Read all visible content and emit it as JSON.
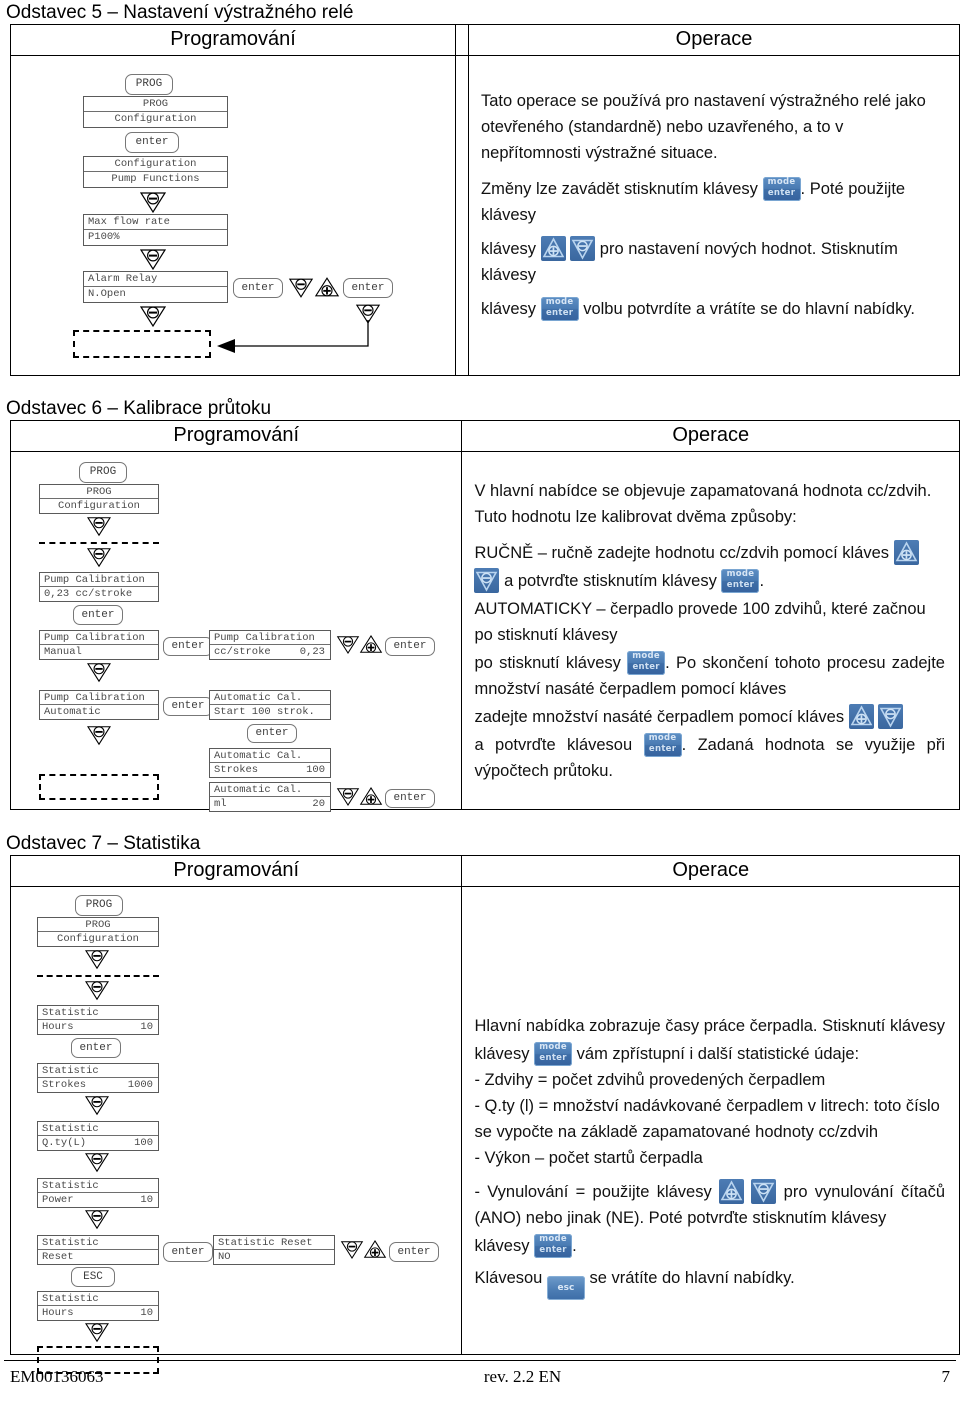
{
  "sections": [
    {
      "id": "sec5",
      "title": "Odstavec 5 – Nastavení výstražného relé",
      "col_left_header": "Programování",
      "col_right_header": "Operace",
      "diagram": {
        "buttons": [
          {
            "label": "PROG"
          },
          {
            "label": "enter"
          },
          {
            "label": "enter"
          },
          {
            "label": "enter"
          }
        ],
        "screens": [
          {
            "line1": "PROG",
            "line2": "Configuration"
          },
          {
            "line1": "Configuration",
            "line2": "Pump Functions"
          },
          {
            "line1": "Max flow rate",
            "line2": "P100%"
          },
          {
            "line1": "Alarm Relay",
            "line2": "N.Open"
          }
        ]
      },
      "prose": {
        "p1": "Tato operace se používá pro nastavení výstražného relé jako otevřeného (standardně) nebo uzavřeného, a to v nepřítomnosti výstražné situace.",
        "p2a": "Změny lze zavádět stisknutím klávesy",
        "p2b": ". Poté použijte klávesy",
        "p2c": "pro nastavení nových hodnot. Stisknutím klávesy",
        "p2d": "volbu potvrdíte a vrátíte se do hlavní nabídky."
      }
    },
    {
      "id": "sec6",
      "title": "Odstavec 6 – Kalibrace průtoku",
      "col_left_header": "Programování",
      "col_right_header": "Operace",
      "diagram": {
        "buttons": [
          {
            "label": "PROG"
          },
          {
            "label": "enter"
          },
          {
            "label": "enter"
          },
          {
            "label": "enter"
          },
          {
            "label": "enter"
          },
          {
            "label": "enter"
          },
          {
            "label": "enter"
          }
        ],
        "screens": [
          {
            "line1": "PROG",
            "line2": "Configuration"
          },
          {
            "line1": "Pump Calibration",
            "line2": "0,23 cc/stroke"
          },
          {
            "line1": "Pump Calibration",
            "line2": "Manual"
          },
          {
            "line1": "Pump Calibration",
            "line2_left": "cc/stroke",
            "line2_right": "0,23"
          },
          {
            "line1": "Pump Calibration",
            "line2": "Automatic"
          },
          {
            "line1": "Automatic Cal.",
            "line2": "Start 100 strok."
          },
          {
            "line1": "Automatic Cal.",
            "line2_left": "Strokes",
            "line2_right": "100"
          },
          {
            "line1": "Automatic Cal.",
            "line2_left": "ml",
            "line2_right": "20"
          }
        ]
      },
      "prose": {
        "p1": "V hlavní nabídce se objevuje zapamatovaná hodnota cc/zdvih. Tuto hodnotu lze kalibrovat dvěma způsoby:",
        "p2a": "RUČNĚ – ručně zadejte hodnotu cc/zdvih pomocí kláves",
        "p2b": "a potvrďte stisknutím klávesy",
        "p2c": ".",
        "p3a": "AUTOMATICKY – čerpadlo provede 100 zdvihů, které začnou po stisknutí klávesy",
        "p3b": ". Po skončení tohoto procesu zadejte množství nasáté čerpadlem pomocí kláves",
        "p3c": "a potvrďte klávesou",
        "p3d": ". Zadaná hodnota se využije při výpočtech průtoku."
      }
    },
    {
      "id": "sec7",
      "title": "Odstavec 7 – Statistika",
      "col_left_header": "Programování",
      "col_right_header": "Operace",
      "diagram": {
        "buttons": [
          {
            "label": "PROG"
          },
          {
            "label": "enter"
          },
          {
            "label": "enter"
          },
          {
            "label": "enter"
          },
          {
            "label": "ESC"
          }
        ],
        "screens": [
          {
            "line1": "PROG",
            "line2": "Configuration"
          },
          {
            "line1": "Statistic",
            "line2_left": "Hours",
            "line2_right": "10"
          },
          {
            "line1": "Statistic",
            "line2_left": "Strokes",
            "line2_right": "1000"
          },
          {
            "line1": "Statistic",
            "line2_left": "Q.ty(L)",
            "line2_right": "100"
          },
          {
            "line1": "Statistic",
            "line2_left": "Power",
            "line2_right": "10"
          },
          {
            "line1": "Statistic",
            "line2": "Reset"
          },
          {
            "line1": "Statistic Reset",
            "line2": "NO"
          },
          {
            "line1": "Statistic",
            "line2_left": "Hours",
            "line2_right": "10"
          }
        ]
      },
      "prose": {
        "p1": "Hlavní nabídka zobrazuje časy práce čerpadla. Stisknutí klávesy",
        "p1b": "vám zpřístupní i další statistické údaje:",
        "b1": "- Zdvihy = počet zdvihů provedených čerpadlem",
        "b2": "- Q.ty (l) = množství nadávkované čerpadlem v litrech: toto číslo se vypočte na základě zapamatované hodnoty cc/zdvih",
        "b3": "- Výkon – počet startů čerpadla",
        "p2a": "- Vynulování = použijte klávesy",
        "p2b": "pro vynulování čítačů (ANO) nebo jinak (NE). Poté potvrďte stisknutím klávesy",
        "p2c": ".",
        "p3a": "Klávesou",
        "p3b": "se vrátíte do hlavní nabídky."
      }
    }
  ],
  "icons": {
    "mode_enter_line1": "mode",
    "mode_enter_line2": "enter",
    "esc_label": "esc",
    "up_key": "up-arrow-plus-key",
    "down_key": "down-arrow-minus-key"
  },
  "footer": {
    "doc_code": "EM00136063",
    "revision": "rev. 2.2   EN",
    "page_number": "7"
  },
  "colors": {
    "key_blue": "#4a7bb3",
    "lcd_border": "#5a5a5a",
    "lcd_text": "#4a4a4a"
  }
}
